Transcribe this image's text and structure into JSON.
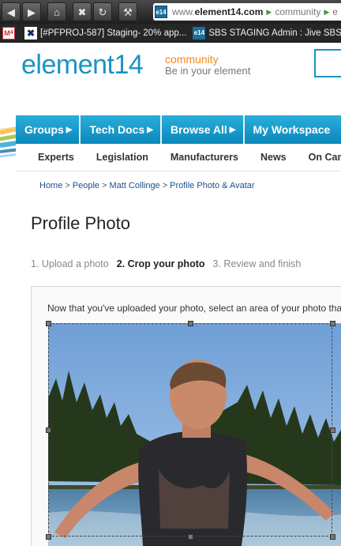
{
  "browser": {
    "address_prefix": "www.",
    "address_domain": "element14.com",
    "address_path": "community",
    "address_more": "e",
    "tabs": [
      {
        "label": "",
        "icon": "gmail-icon"
      },
      {
        "label": "[#PFPROJ-587] Staging- 20% app...",
        "icon": "jira-icon"
      },
      {
        "label": "SBS STAGING Admin : Jive SBS",
        "icon": "element14-icon"
      }
    ],
    "gmail_count": "4"
  },
  "site": {
    "logo_word": "element",
    "logo_num": "14",
    "tagline_1": "community",
    "tagline_2": "Be in your element",
    "nav": [
      {
        "label": "Groups"
      },
      {
        "label": "Tech Docs"
      },
      {
        "label": "Browse All"
      },
      {
        "label": "My Workspace"
      }
    ],
    "subnav": [
      "Experts",
      "Legislation",
      "Manufacturers",
      "News",
      "On Campus"
    ]
  },
  "breadcrumb": [
    "Home",
    "People",
    "Matt Collinge",
    "Profile Photo & Avatar"
  ],
  "page_title": "Profile Photo",
  "steps": {
    "step1": "1. Upload a photo",
    "step2": "2. Crop your photo",
    "step3": "3. Review and finish"
  },
  "instruction": "Now that you've uploaded your photo, select an area of your photo tha",
  "colors": {
    "brand_blue": "#1a93c3",
    "brand_orange": "#f08a1c",
    "nav_blue": "#0a88ba"
  }
}
